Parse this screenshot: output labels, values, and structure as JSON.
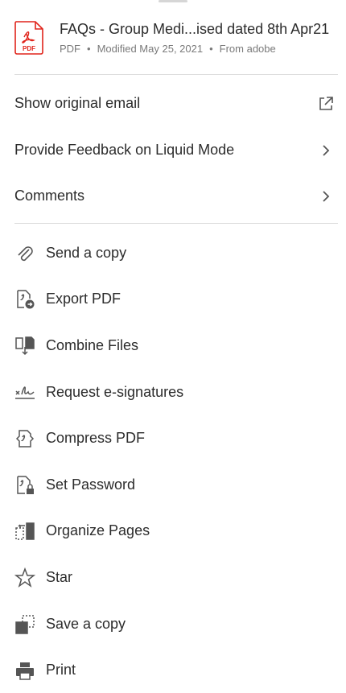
{
  "file": {
    "title": "FAQs - Group Medi...ised dated 8th Apr21",
    "type": "PDF",
    "modified": "Modified May 25, 2021",
    "source": "From adobe",
    "icon_label": "PDF",
    "accent": "#e0241b"
  },
  "top_menu": [
    {
      "label": "Show original email",
      "icon": "external-link-icon"
    },
    {
      "label": "Provide Feedback on Liquid Mode",
      "icon": "chevron-right-icon"
    },
    {
      "label": "Comments",
      "icon": "chevron-right-icon"
    }
  ],
  "tools": [
    {
      "label": "Send a copy",
      "icon": "paperclip-icon"
    },
    {
      "label": "Export PDF",
      "icon": "export-pdf-icon"
    },
    {
      "label": "Combine Files",
      "icon": "combine-files-icon"
    },
    {
      "label": "Request e-signatures",
      "icon": "signature-icon"
    },
    {
      "label": "Compress PDF",
      "icon": "compress-pdf-icon"
    },
    {
      "label": "Set Password",
      "icon": "lock-file-icon"
    },
    {
      "label": "Organize Pages",
      "icon": "organize-pages-icon"
    },
    {
      "label": "Star",
      "icon": "star-icon"
    },
    {
      "label": "Save a copy",
      "icon": "save-copy-icon"
    },
    {
      "label": "Print",
      "icon": "printer-icon"
    }
  ]
}
